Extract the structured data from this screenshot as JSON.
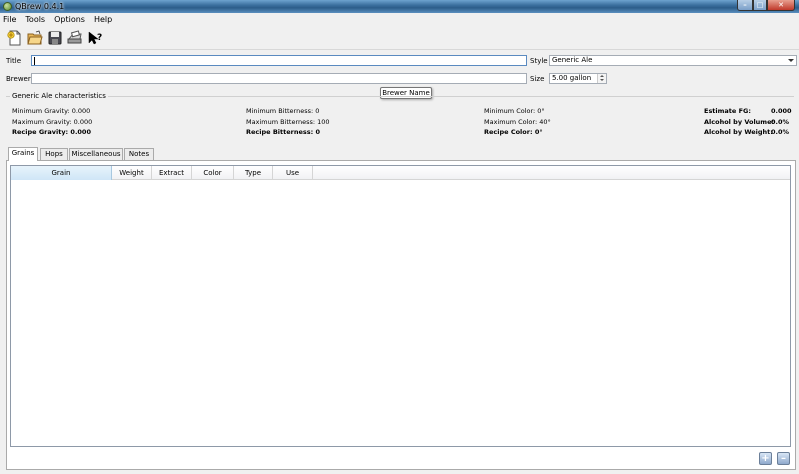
{
  "window": {
    "title": "QBrew 0.4.1"
  },
  "menu": [
    "File",
    "Tools",
    "Options",
    "Help"
  ],
  "toolbar_icons": [
    "new-icon",
    "open-icon",
    "save-icon",
    "print-icon",
    "whats-this-icon"
  ],
  "form": {
    "title_label": "Title",
    "title_value": "",
    "brewer_label": "Brewer",
    "brewer_value": "",
    "style_label": "Style",
    "style_value": "Generic Ale",
    "size_label": "Size",
    "size_value": "5.00 gallon",
    "tooltip": "Brewer Name"
  },
  "characteristics": {
    "title": "Generic Ale characteristics",
    "min_gravity": "Minimum Gravity:  0.000",
    "max_gravity": "Maximum Gravity: 0.000",
    "recipe_gravity": "Recipe Gravity: 0.000",
    "min_bitterness": "Minimum Bitterness:  0",
    "max_bitterness": "Maximum Bitterness:  100",
    "recipe_bitterness": "Recipe Bitterness: 0",
    "min_color": "Minimum Color:  0°",
    "max_color": "Maximum Color:  40°",
    "recipe_color": "Recipe Color:  0°",
    "estimate_fg_label": "Estimate FG:",
    "estimate_fg_value": "0.000",
    "abv_label": "Alcohol by Volume:",
    "abv_value": "0.0%",
    "abw_label": "Alcohol by Weight:",
    "abw_value": "0.0%"
  },
  "tabs": [
    "Grains",
    "Hops",
    "Miscellaneous",
    "Notes"
  ],
  "table": {
    "columns": [
      "Grain",
      "Weight",
      "Extract",
      "Color",
      "Type",
      "Use"
    ]
  },
  "colors": {
    "accent": "#3b6f9e",
    "close": "#c0392b"
  }
}
